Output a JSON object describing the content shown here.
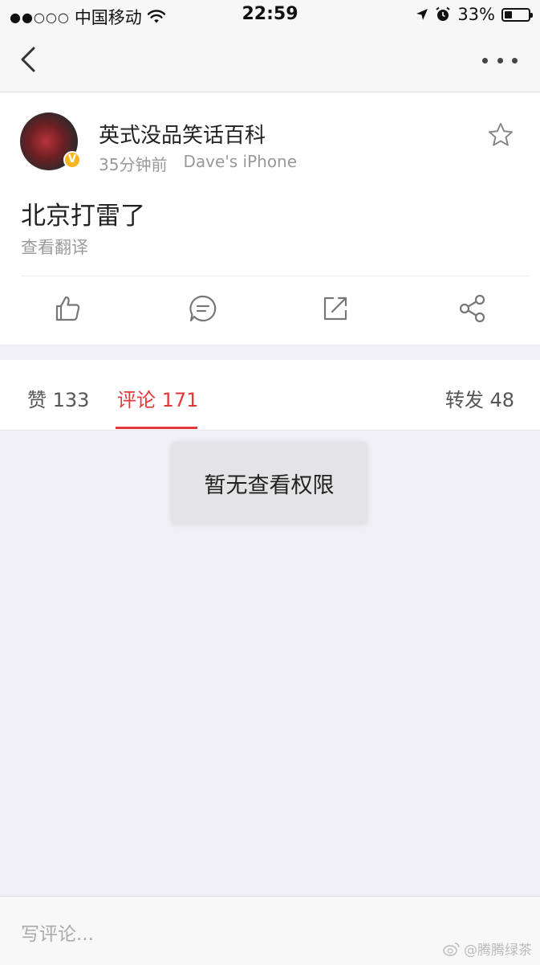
{
  "status_bar": {
    "carrier": "中国移动",
    "time": "22:59",
    "battery_percent": "33%",
    "battery_level": 0.33,
    "signal_dots": "●●○○○"
  },
  "post": {
    "author": "英式没品笑话百科",
    "time_ago": "35分钟前",
    "device": "Dave's iPhone",
    "text": "北京打雷了",
    "translate_label": "查看翻译",
    "verified_badge": "V"
  },
  "tabs": [
    {
      "label": "赞 133"
    },
    {
      "label": "评论 171"
    },
    {
      "label": "转发 48"
    }
  ],
  "toast": {
    "message": "暂无查看权限"
  },
  "comment_bar": {
    "placeholder": "写评论...",
    "watermark": "@腾腾绿茶"
  },
  "colors": {
    "accent": "#e5383b",
    "background": "#efeff4",
    "verified": "#f6b624"
  }
}
